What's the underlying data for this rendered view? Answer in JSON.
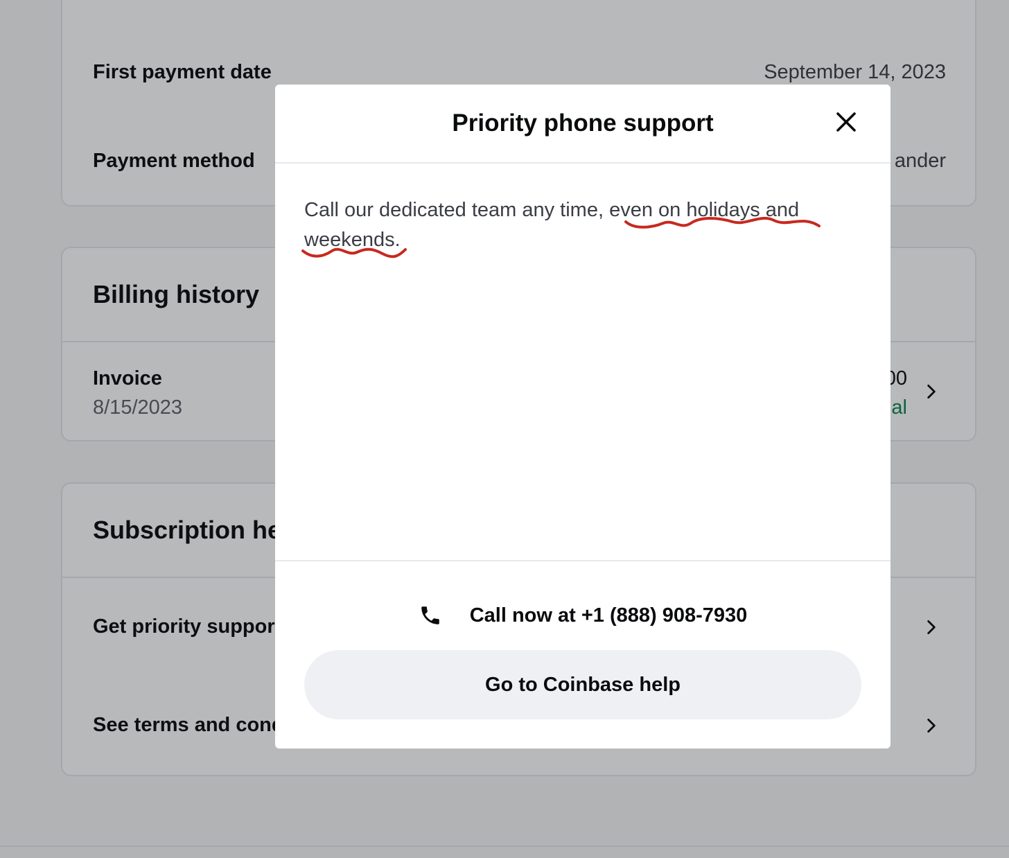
{
  "details": {
    "first_payment_label": "First payment date",
    "first_payment_value": "September 14, 2023",
    "payment_method_label": "Payment method",
    "payment_method_value": "ander"
  },
  "billing": {
    "title": "Billing history",
    "invoice_label": "Invoice",
    "invoice_date": "8/15/2023",
    "amount_partial": "00",
    "status_partial": "al"
  },
  "help": {
    "title": "Subscription he",
    "priority_label": "Get priority suppor",
    "terms_label": "See terms and cond"
  },
  "modal": {
    "title": "Priority phone support",
    "body_plain": "Call our dedicated team any time, ",
    "body_underlined_1": "even on holidays and",
    "body_underlined_2": "weekends.",
    "call_label": "Call now at +1 (888) 908-7930",
    "help_button": "Go to Coinbase help"
  },
  "colors": {
    "accent_green": "#098551",
    "annotation_red": "#c8281e"
  }
}
